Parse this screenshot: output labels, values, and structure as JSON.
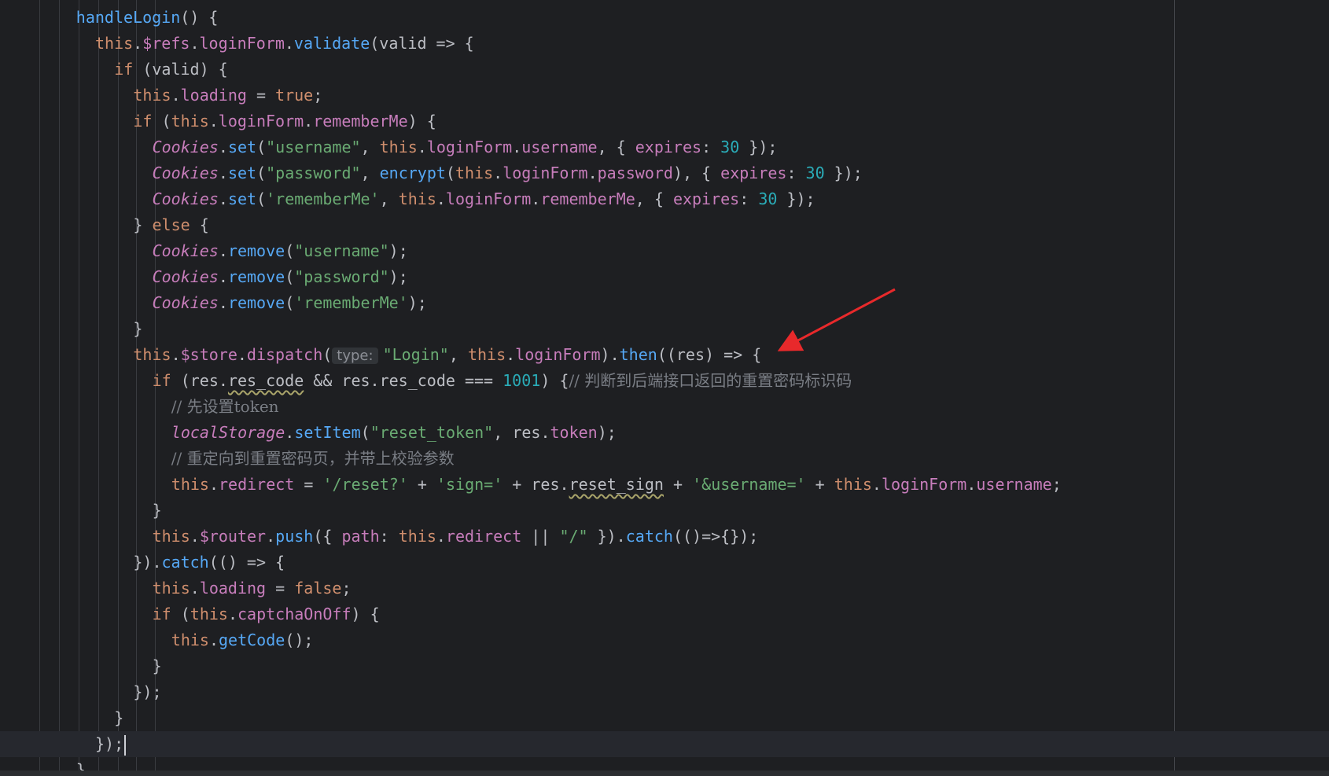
{
  "editor": {
    "indent_guides": [
      50,
      75,
      100,
      125,
      150,
      173,
      197
    ],
    "colors": {
      "background": "#1e1f22",
      "keyword": "#cf8e6d",
      "function": "#56a8f5",
      "property": "#c77dbb",
      "string": "#6aab73",
      "number": "#2aacb8",
      "comment": "#7a7e85",
      "annotation_arrow": "#e8292b"
    },
    "current_line": 28,
    "lines": [
      {
        "indent": 4,
        "tokens": [
          [
            "fn",
            "handleLogin"
          ],
          [
            "plain",
            "() {"
          ]
        ]
      },
      {
        "indent": 5,
        "tokens": [
          [
            "kw",
            "this"
          ],
          [
            "plain",
            "."
          ],
          [
            "prop",
            "$refs"
          ],
          [
            "plain",
            "."
          ],
          [
            "prop",
            "loginForm"
          ],
          [
            "plain",
            "."
          ],
          [
            "fn",
            "validate"
          ],
          [
            "plain",
            "(valid => {"
          ]
        ]
      },
      {
        "indent": 6,
        "tokens": [
          [
            "kw",
            "if"
          ],
          [
            "plain",
            " (valid) {"
          ]
        ]
      },
      {
        "indent": 7,
        "tokens": [
          [
            "kw",
            "this"
          ],
          [
            "plain",
            "."
          ],
          [
            "prop",
            "loading"
          ],
          [
            "plain",
            " = "
          ],
          [
            "kw",
            "true"
          ],
          [
            "plain",
            ";"
          ]
        ]
      },
      {
        "indent": 7,
        "tokens": [
          [
            "kw",
            "if"
          ],
          [
            "plain",
            " ("
          ],
          [
            "kw",
            "this"
          ],
          [
            "plain",
            "."
          ],
          [
            "prop",
            "loginForm"
          ],
          [
            "plain",
            "."
          ],
          [
            "prop",
            "rememberMe"
          ],
          [
            "plain",
            ") {"
          ]
        ]
      },
      {
        "indent": 8,
        "tokens": [
          [
            "cls",
            "Cookies"
          ],
          [
            "plain",
            "."
          ],
          [
            "fn",
            "set"
          ],
          [
            "plain",
            "("
          ],
          [
            "str",
            "\"username\""
          ],
          [
            "plain",
            ", "
          ],
          [
            "kw",
            "this"
          ],
          [
            "plain",
            "."
          ],
          [
            "prop",
            "loginForm"
          ],
          [
            "plain",
            "."
          ],
          [
            "prop",
            "username"
          ],
          [
            "plain",
            ", { "
          ],
          [
            "prop",
            "expires"
          ],
          [
            "plain",
            ": "
          ],
          [
            "num",
            "30"
          ],
          [
            "plain",
            " });"
          ]
        ]
      },
      {
        "indent": 8,
        "tokens": [
          [
            "cls",
            "Cookies"
          ],
          [
            "plain",
            "."
          ],
          [
            "fn",
            "set"
          ],
          [
            "plain",
            "("
          ],
          [
            "str",
            "\"password\""
          ],
          [
            "plain",
            ", "
          ],
          [
            "fn",
            "encrypt"
          ],
          [
            "plain",
            "("
          ],
          [
            "kw",
            "this"
          ],
          [
            "plain",
            "."
          ],
          [
            "prop",
            "loginForm"
          ],
          [
            "plain",
            "."
          ],
          [
            "prop",
            "password"
          ],
          [
            "plain",
            "), { "
          ],
          [
            "prop",
            "expires"
          ],
          [
            "plain",
            ": "
          ],
          [
            "num",
            "30"
          ],
          [
            "plain",
            " });"
          ]
        ]
      },
      {
        "indent": 8,
        "tokens": [
          [
            "cls",
            "Cookies"
          ],
          [
            "plain",
            "."
          ],
          [
            "fn",
            "set"
          ],
          [
            "plain",
            "("
          ],
          [
            "str",
            "'rememberMe'"
          ],
          [
            "plain",
            ", "
          ],
          [
            "kw",
            "this"
          ],
          [
            "plain",
            "."
          ],
          [
            "prop",
            "loginForm"
          ],
          [
            "plain",
            "."
          ],
          [
            "prop",
            "rememberMe"
          ],
          [
            "plain",
            ", { "
          ],
          [
            "prop",
            "expires"
          ],
          [
            "plain",
            ": "
          ],
          [
            "num",
            "30"
          ],
          [
            "plain",
            " });"
          ]
        ]
      },
      {
        "indent": 7,
        "tokens": [
          [
            "plain",
            "} "
          ],
          [
            "kw",
            "else"
          ],
          [
            "plain",
            " {"
          ]
        ]
      },
      {
        "indent": 8,
        "tokens": [
          [
            "cls",
            "Cookies"
          ],
          [
            "plain",
            "."
          ],
          [
            "fn",
            "remove"
          ],
          [
            "plain",
            "("
          ],
          [
            "str",
            "\"username\""
          ],
          [
            "plain",
            ");"
          ]
        ]
      },
      {
        "indent": 8,
        "tokens": [
          [
            "cls",
            "Cookies"
          ],
          [
            "plain",
            "."
          ],
          [
            "fn",
            "remove"
          ],
          [
            "plain",
            "("
          ],
          [
            "str",
            "\"password\""
          ],
          [
            "plain",
            ");"
          ]
        ]
      },
      {
        "indent": 8,
        "tokens": [
          [
            "cls",
            "Cookies"
          ],
          [
            "plain",
            "."
          ],
          [
            "fn",
            "remove"
          ],
          [
            "plain",
            "("
          ],
          [
            "str",
            "'rememberMe'"
          ],
          [
            "plain",
            ");"
          ]
        ]
      },
      {
        "indent": 7,
        "tokens": [
          [
            "plain",
            "}"
          ]
        ]
      },
      {
        "indent": 7,
        "tokens": [
          [
            "kw",
            "this"
          ],
          [
            "plain",
            "."
          ],
          [
            "prop",
            "$store"
          ],
          [
            "plain",
            "."
          ],
          [
            "prop",
            "dispatch"
          ],
          [
            "plain",
            "("
          ],
          [
            "hint",
            "type:"
          ],
          [
            "str",
            "\"Login\""
          ],
          [
            "plain",
            ", "
          ],
          [
            "kw",
            "this"
          ],
          [
            "plain",
            "."
          ],
          [
            "prop",
            "loginForm"
          ],
          [
            "plain",
            ")."
          ],
          [
            "fn",
            "then"
          ],
          [
            "plain",
            "((res) => {"
          ]
        ]
      },
      {
        "indent": 8,
        "tokens": [
          [
            "kw",
            "if"
          ],
          [
            "plain",
            " (res."
          ],
          [
            "plainsq",
            "res_code"
          ],
          [
            "plain",
            " && res.res_code === "
          ],
          [
            "num",
            "1001"
          ],
          [
            "plain",
            ") {"
          ],
          [
            "cm",
            "// 判断到后端接口返回的重置密码标识码"
          ]
        ]
      },
      {
        "indent": 9,
        "tokens": [
          [
            "cm",
            "// 先设置token"
          ]
        ]
      },
      {
        "indent": 9,
        "tokens": [
          [
            "cls",
            "localStorage"
          ],
          [
            "plain",
            "."
          ],
          [
            "fn",
            "setItem"
          ],
          [
            "plain",
            "("
          ],
          [
            "str",
            "\"reset_token\""
          ],
          [
            "plain",
            ", res."
          ],
          [
            "prop",
            "token"
          ],
          [
            "plain",
            ");"
          ]
        ]
      },
      {
        "indent": 9,
        "tokens": [
          [
            "cm",
            "// 重定向到重置密码页，并带上校验参数"
          ]
        ]
      },
      {
        "indent": 9,
        "tokens": [
          [
            "kw",
            "this"
          ],
          [
            "plain",
            "."
          ],
          [
            "prop",
            "redirect"
          ],
          [
            "plain",
            " = "
          ],
          [
            "str",
            "'/reset?'"
          ],
          [
            "plain",
            " + "
          ],
          [
            "str",
            "'sign='"
          ],
          [
            "plain",
            " + res."
          ],
          [
            "plainsq",
            "reset_sign"
          ],
          [
            "plain",
            " + "
          ],
          [
            "str",
            "'&username='"
          ],
          [
            "plain",
            " + "
          ],
          [
            "kw",
            "this"
          ],
          [
            "plain",
            "."
          ],
          [
            "prop",
            "loginForm"
          ],
          [
            "plain",
            "."
          ],
          [
            "prop",
            "username"
          ],
          [
            "plain",
            ";"
          ]
        ]
      },
      {
        "indent": 8,
        "tokens": [
          [
            "plain",
            "}"
          ]
        ]
      },
      {
        "indent": 8,
        "tokens": [
          [
            "kw",
            "this"
          ],
          [
            "plain",
            "."
          ],
          [
            "prop",
            "$router"
          ],
          [
            "plain",
            "."
          ],
          [
            "fn",
            "push"
          ],
          [
            "plain",
            "({ "
          ],
          [
            "prop",
            "path"
          ],
          [
            "plain",
            ": "
          ],
          [
            "kw",
            "this"
          ],
          [
            "plain",
            "."
          ],
          [
            "prop",
            "redirect"
          ],
          [
            "plain",
            " || "
          ],
          [
            "str",
            "\"/\""
          ],
          [
            "plain",
            " })."
          ],
          [
            "fn",
            "catch"
          ],
          [
            "plain",
            "(()=>{});"
          ]
        ]
      },
      {
        "indent": 7,
        "tokens": [
          [
            "plain",
            "})."
          ],
          [
            "fn",
            "catch"
          ],
          [
            "plain",
            "(() => {"
          ]
        ]
      },
      {
        "indent": 8,
        "tokens": [
          [
            "kw",
            "this"
          ],
          [
            "plain",
            "."
          ],
          [
            "prop",
            "loading"
          ],
          [
            "plain",
            " = "
          ],
          [
            "kw",
            "false"
          ],
          [
            "plain",
            ";"
          ]
        ]
      },
      {
        "indent": 8,
        "tokens": [
          [
            "kw",
            "if"
          ],
          [
            "plain",
            " ("
          ],
          [
            "kw",
            "this"
          ],
          [
            "plain",
            "."
          ],
          [
            "prop",
            "captchaOnOff"
          ],
          [
            "plain",
            ") {"
          ]
        ]
      },
      {
        "indent": 9,
        "tokens": [
          [
            "kw",
            "this"
          ],
          [
            "plain",
            "."
          ],
          [
            "fn",
            "getCode"
          ],
          [
            "plain",
            "();"
          ]
        ]
      },
      {
        "indent": 8,
        "tokens": [
          [
            "plain",
            "}"
          ]
        ]
      },
      {
        "indent": 7,
        "tokens": [
          [
            "plain",
            "});"
          ]
        ]
      },
      {
        "indent": 6,
        "tokens": [
          [
            "plain",
            "}"
          ]
        ]
      },
      {
        "indent": 5,
        "tokens": [
          [
            "plain",
            "});"
          ]
        ]
      },
      {
        "indent": 4,
        "tokens": [
          [
            "plain",
            "}"
          ]
        ]
      }
    ]
  }
}
